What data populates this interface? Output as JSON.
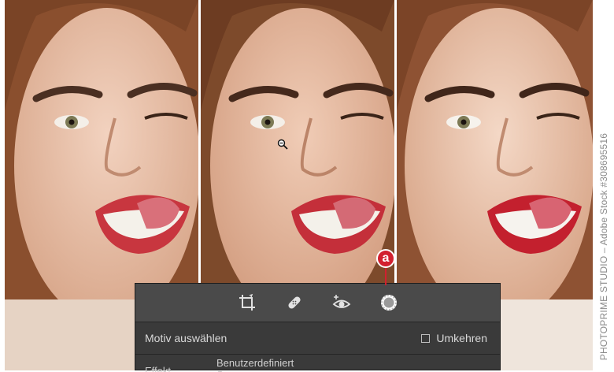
{
  "photos": {
    "credit": "PHOTOPRIME STUDIO – Adobe Stock #308695516"
  },
  "panel": {
    "toolbar": {
      "tools": [
        {
          "icon": "crop-icon"
        },
        {
          "icon": "healing-bandage-icon"
        },
        {
          "icon": "red-eye-icon"
        },
        {
          "icon": "masking-icon"
        }
      ]
    },
    "subject_label": "Motiv auswählen",
    "invert_label": "Umkehren",
    "invert_checked": false,
    "effect_label": "Effekt",
    "effect_value": "Benutzerdefiniert"
  },
  "annotation": {
    "callout_letter": "a",
    "callout_color": "#d2202f"
  }
}
